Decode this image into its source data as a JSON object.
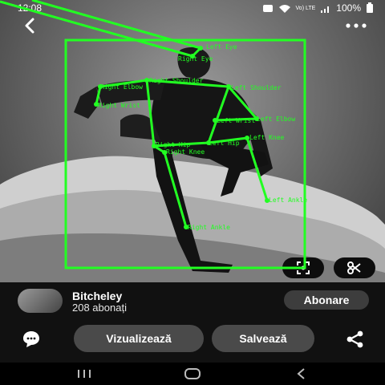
{
  "status": {
    "time": "12:08",
    "battery": "100%",
    "network": "Vo) LTE"
  },
  "pose": {
    "labels": {
      "left_eye": "Left Eye",
      "right_eye": "Right Eye",
      "left_shoulder": "Left Shoulder",
      "right_shoulder": "Right Shoulder",
      "left_elbow": "Left Elbow",
      "right_elbow": "Right Elbow",
      "left_wrist": "Left Wrist",
      "right_wrist": "Right Wrist",
      "left_hip": "Left Hip",
      "right_hip": "Right Hip",
      "left_knee": "Left Knee",
      "right_knee": "Right Knee",
      "left_ankle": "Left Ankle",
      "right_ankle": "Right Ankle"
    }
  },
  "profile": {
    "name": "Bitcheley",
    "followers": "208 abonați",
    "follow_label": "Abonare"
  },
  "actions": {
    "visit_label": "Vizualizează",
    "save_label": "Salvează"
  },
  "icons": {
    "back": "back-arrow-icon",
    "more": "more-dots-icon",
    "lens": "visual-search-icon",
    "scissors": "scissors-icon",
    "comment": "comment-icon",
    "share": "share-icon"
  },
  "colors": {
    "pose": "#22ff22",
    "panel": "#111111",
    "pill": "#4a4a4a"
  }
}
